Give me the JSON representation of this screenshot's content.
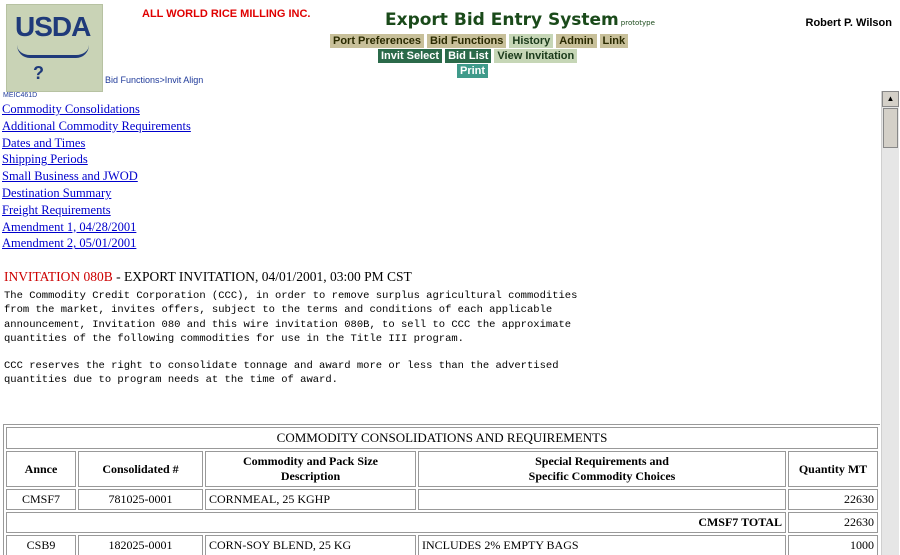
{
  "header": {
    "logo_text": "USDA",
    "company": "ALL WORLD RICE MILLING INC.",
    "app_title": "Export Bid Entry System",
    "app_subtitle": "prototype",
    "user": "Robert P. Wilson",
    "breadcrumb": "Bid Functions>Invit Align",
    "page_code": "MEIC461D",
    "help_icon": "?"
  },
  "nav_primary": [
    "Port Preferences",
    "Bid Functions",
    "History",
    "Admin",
    "Link"
  ],
  "nav_secondary": [
    "Invit Select",
    "Bid List",
    "View Invitation"
  ],
  "nav_print": "Print",
  "links": [
    "Commodity Consolidations",
    "Additional Commodity Requirements",
    "Dates and Times",
    "Shipping Periods",
    "Small Business and JWOD",
    "Destination Summary",
    "Freight Requirements",
    "Amendment 1, 04/28/2001",
    "Amendment 2, 05/01/2001"
  ],
  "invitation": {
    "id": "INVITATION 080B",
    "title_rest": " - EXPORT INVITATION, 04/01/2001, 03:00 PM CST",
    "para1": "The Commodity Credit Corporation (CCC), in order to remove surplus agricultural commodities\nfrom the market, invites offers, subject to the terms and conditions of each applicable\nannouncement, Invitation 080 and this wire invitation 080B, to sell to CCC the approximate\nquantities of the following commodities for use in the Title III program.",
    "para2": "CCC reserves the right to consolidate tonnage and award more or less than the advertised\nquantities due to program needs at the time of award."
  },
  "table": {
    "title": "COMMODITY CONSOLIDATIONS AND REQUIREMENTS",
    "headers": {
      "annce": "Annce",
      "consolidated": "Consolidated #",
      "commodity_line1": "Commodity and Pack Size",
      "commodity_line2": "Description",
      "special_line1": "Special Requirements and",
      "special_line2": "Specific Commodity Choices",
      "quantity": "Quantity MT"
    },
    "rows": [
      {
        "annce": "CMSF7",
        "consolidated": "781025-0001",
        "commodity": "CORNMEAL, 25 KGHP",
        "special": "",
        "quantity": "22630"
      },
      {
        "total_label": "CMSF7 TOTAL",
        "total_value": "22630"
      },
      {
        "annce": "CSB9",
        "consolidated": "182025-0001",
        "commodity": "CORN-SOY BLEND, 25 KG",
        "special": "INCLUDES 2% EMPTY BAGS",
        "quantity": "1000"
      }
    ]
  }
}
